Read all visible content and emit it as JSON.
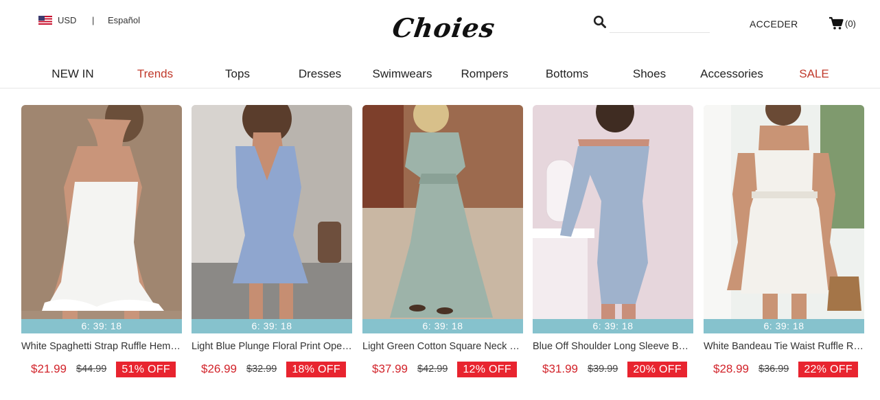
{
  "header": {
    "currency": "USD",
    "separator": "|",
    "language": "Español",
    "logo": "Choies",
    "search_placeholder": "",
    "login": "ACCEDER",
    "cart_count": "(0)",
    "icons": [
      "us-flag-icon",
      "search-icon",
      "cart-icon"
    ]
  },
  "nav": {
    "items": [
      {
        "label": "NEW IN",
        "color": "#222222"
      },
      {
        "label": "Trends",
        "color": "#c0392b"
      },
      {
        "label": "Tops",
        "color": "#222222"
      },
      {
        "label": "Dresses",
        "color": "#222222"
      },
      {
        "label": "Swimwears",
        "color": "#222222"
      },
      {
        "label": "Rompers",
        "color": "#222222"
      },
      {
        "label": "Bottoms",
        "color": "#222222"
      },
      {
        "label": "Shoes",
        "color": "#222222"
      },
      {
        "label": "Accessories",
        "color": "#222222"
      },
      {
        "label": "SALE",
        "color": "#c0392b"
      }
    ]
  },
  "products": [
    {
      "title": "White Spaghetti Strap Ruffle Hem Mini Dress",
      "timer": "6: 39: 18",
      "price": "$21.99",
      "old_price": "$44.99",
      "discount": "51% OFF",
      "dress_color": "#f4f4f2",
      "bg_color": "#a78e79"
    },
    {
      "title": "Light Blue Plunge Floral Print Open Back Mini Dress",
      "timer": "6: 39: 18",
      "price": "$26.99",
      "old_price": "$32.99",
      "discount": "18% OFF",
      "dress_color": "#8fa6cf",
      "bg_color": "#b9b4ae"
    },
    {
      "title": "Light Green Cotton Square Neck Maxi Dress",
      "timer": "6: 39: 18",
      "price": "$37.99",
      "old_price": "$42.99",
      "discount": "12% OFF",
      "dress_color": "#9db3a9",
      "bg_color": "#9c6a4e"
    },
    {
      "title": "Blue Off Shoulder Long Sleeve Bodycon Dress",
      "timer": "6: 39: 18",
      "price": "$31.99",
      "old_price": "$39.99",
      "discount": "20% OFF",
      "dress_color": "#9fb2cc",
      "bg_color": "#e6d6dc"
    },
    {
      "title": "White Bandeau Tie Waist Ruffle Romper",
      "timer": "6: 39: 18",
      "price": "$28.99",
      "old_price": "$36.99",
      "discount": "22% OFF",
      "dress_color": "#f3f1ec",
      "bg_color": "#d7ddd8"
    }
  ]
}
